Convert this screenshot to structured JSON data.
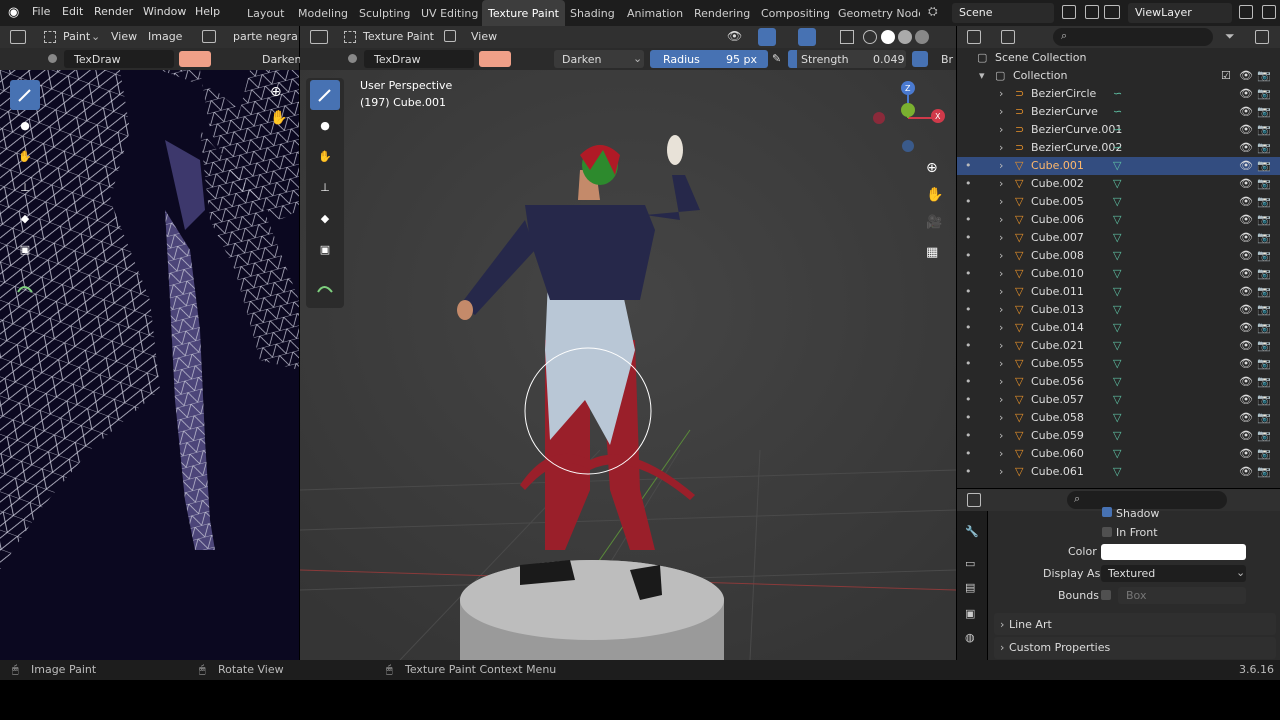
{
  "app": {
    "logo": "blender-logo"
  },
  "menu": [
    "File",
    "Edit",
    "Render",
    "Window",
    "Help"
  ],
  "workspaces": [
    "Layout",
    "Modeling",
    "Sculpting",
    "UV Editing",
    "Texture Paint",
    "Shading",
    "Animation",
    "Rendering",
    "Compositing",
    "Geometry Node"
  ],
  "active_workspace": "Texture Paint",
  "scene": {
    "label": "Scene",
    "viewlayer": "ViewLayer"
  },
  "image_editor": {
    "mode": "Paint",
    "view": "View",
    "image": "Image",
    "image_name": "parte negra s",
    "brush": "TexDraw",
    "blend": "Darken"
  },
  "viewport": {
    "mode": "Texture Paint",
    "view": "View",
    "brush": "TexDraw",
    "blend": "Darken",
    "radius_label": "Radius",
    "radius_value": "95 px",
    "strength_label": "Strength",
    "strength_value": "0.049",
    "extra": "Br",
    "perspective": "User Perspective",
    "object": "(197) Cube.001"
  },
  "outliner": {
    "root": "Scene Collection",
    "collection": "Collection",
    "items": [
      {
        "name": "BezierCircle",
        "type": "curve",
        "selected": false
      },
      {
        "name": "BezierCurve",
        "type": "curve",
        "selected": false
      },
      {
        "name": "BezierCurve.001",
        "type": "curve",
        "selected": false
      },
      {
        "name": "BezierCurve.002",
        "type": "curve",
        "selected": false
      },
      {
        "name": "Cube.001",
        "type": "mesh",
        "selected": true
      },
      {
        "name": "Cube.002",
        "type": "mesh",
        "selected": false
      },
      {
        "name": "Cube.005",
        "type": "mesh",
        "selected": false
      },
      {
        "name": "Cube.006",
        "type": "mesh",
        "selected": false
      },
      {
        "name": "Cube.007",
        "type": "mesh",
        "selected": false
      },
      {
        "name": "Cube.008",
        "type": "mesh",
        "selected": false
      },
      {
        "name": "Cube.010",
        "type": "mesh",
        "selected": false
      },
      {
        "name": "Cube.011",
        "type": "mesh",
        "selected": false
      },
      {
        "name": "Cube.013",
        "type": "mesh",
        "selected": false
      },
      {
        "name": "Cube.014",
        "type": "mesh",
        "selected": false
      },
      {
        "name": "Cube.021",
        "type": "mesh",
        "selected": false
      },
      {
        "name": "Cube.055",
        "type": "mesh",
        "selected": false
      },
      {
        "name": "Cube.056",
        "type": "mesh",
        "selected": false
      },
      {
        "name": "Cube.057",
        "type": "mesh",
        "selected": false
      },
      {
        "name": "Cube.058",
        "type": "mesh",
        "selected": false
      },
      {
        "name": "Cube.059",
        "type": "mesh",
        "selected": false
      },
      {
        "name": "Cube.060",
        "type": "mesh",
        "selected": false
      },
      {
        "name": "Cube.061",
        "type": "mesh",
        "selected": false
      }
    ]
  },
  "properties": {
    "shadow": "Shadow",
    "in_front": "In Front",
    "color_label": "Color",
    "display_as_label": "Display As",
    "display_as_value": "Textured",
    "bounds_label": "Bounds",
    "bounds_value": "Box",
    "line_art": "Line Art",
    "custom_props": "Custom Properties"
  },
  "statusbar": {
    "left": "Image Paint",
    "mid": "Rotate View",
    "right": "Texture Paint Context Menu",
    "version": "3.6.16"
  },
  "colors": {
    "accent": "#4772b3",
    "brush_color": "#f0a088",
    "selected_row": "#334d80"
  }
}
